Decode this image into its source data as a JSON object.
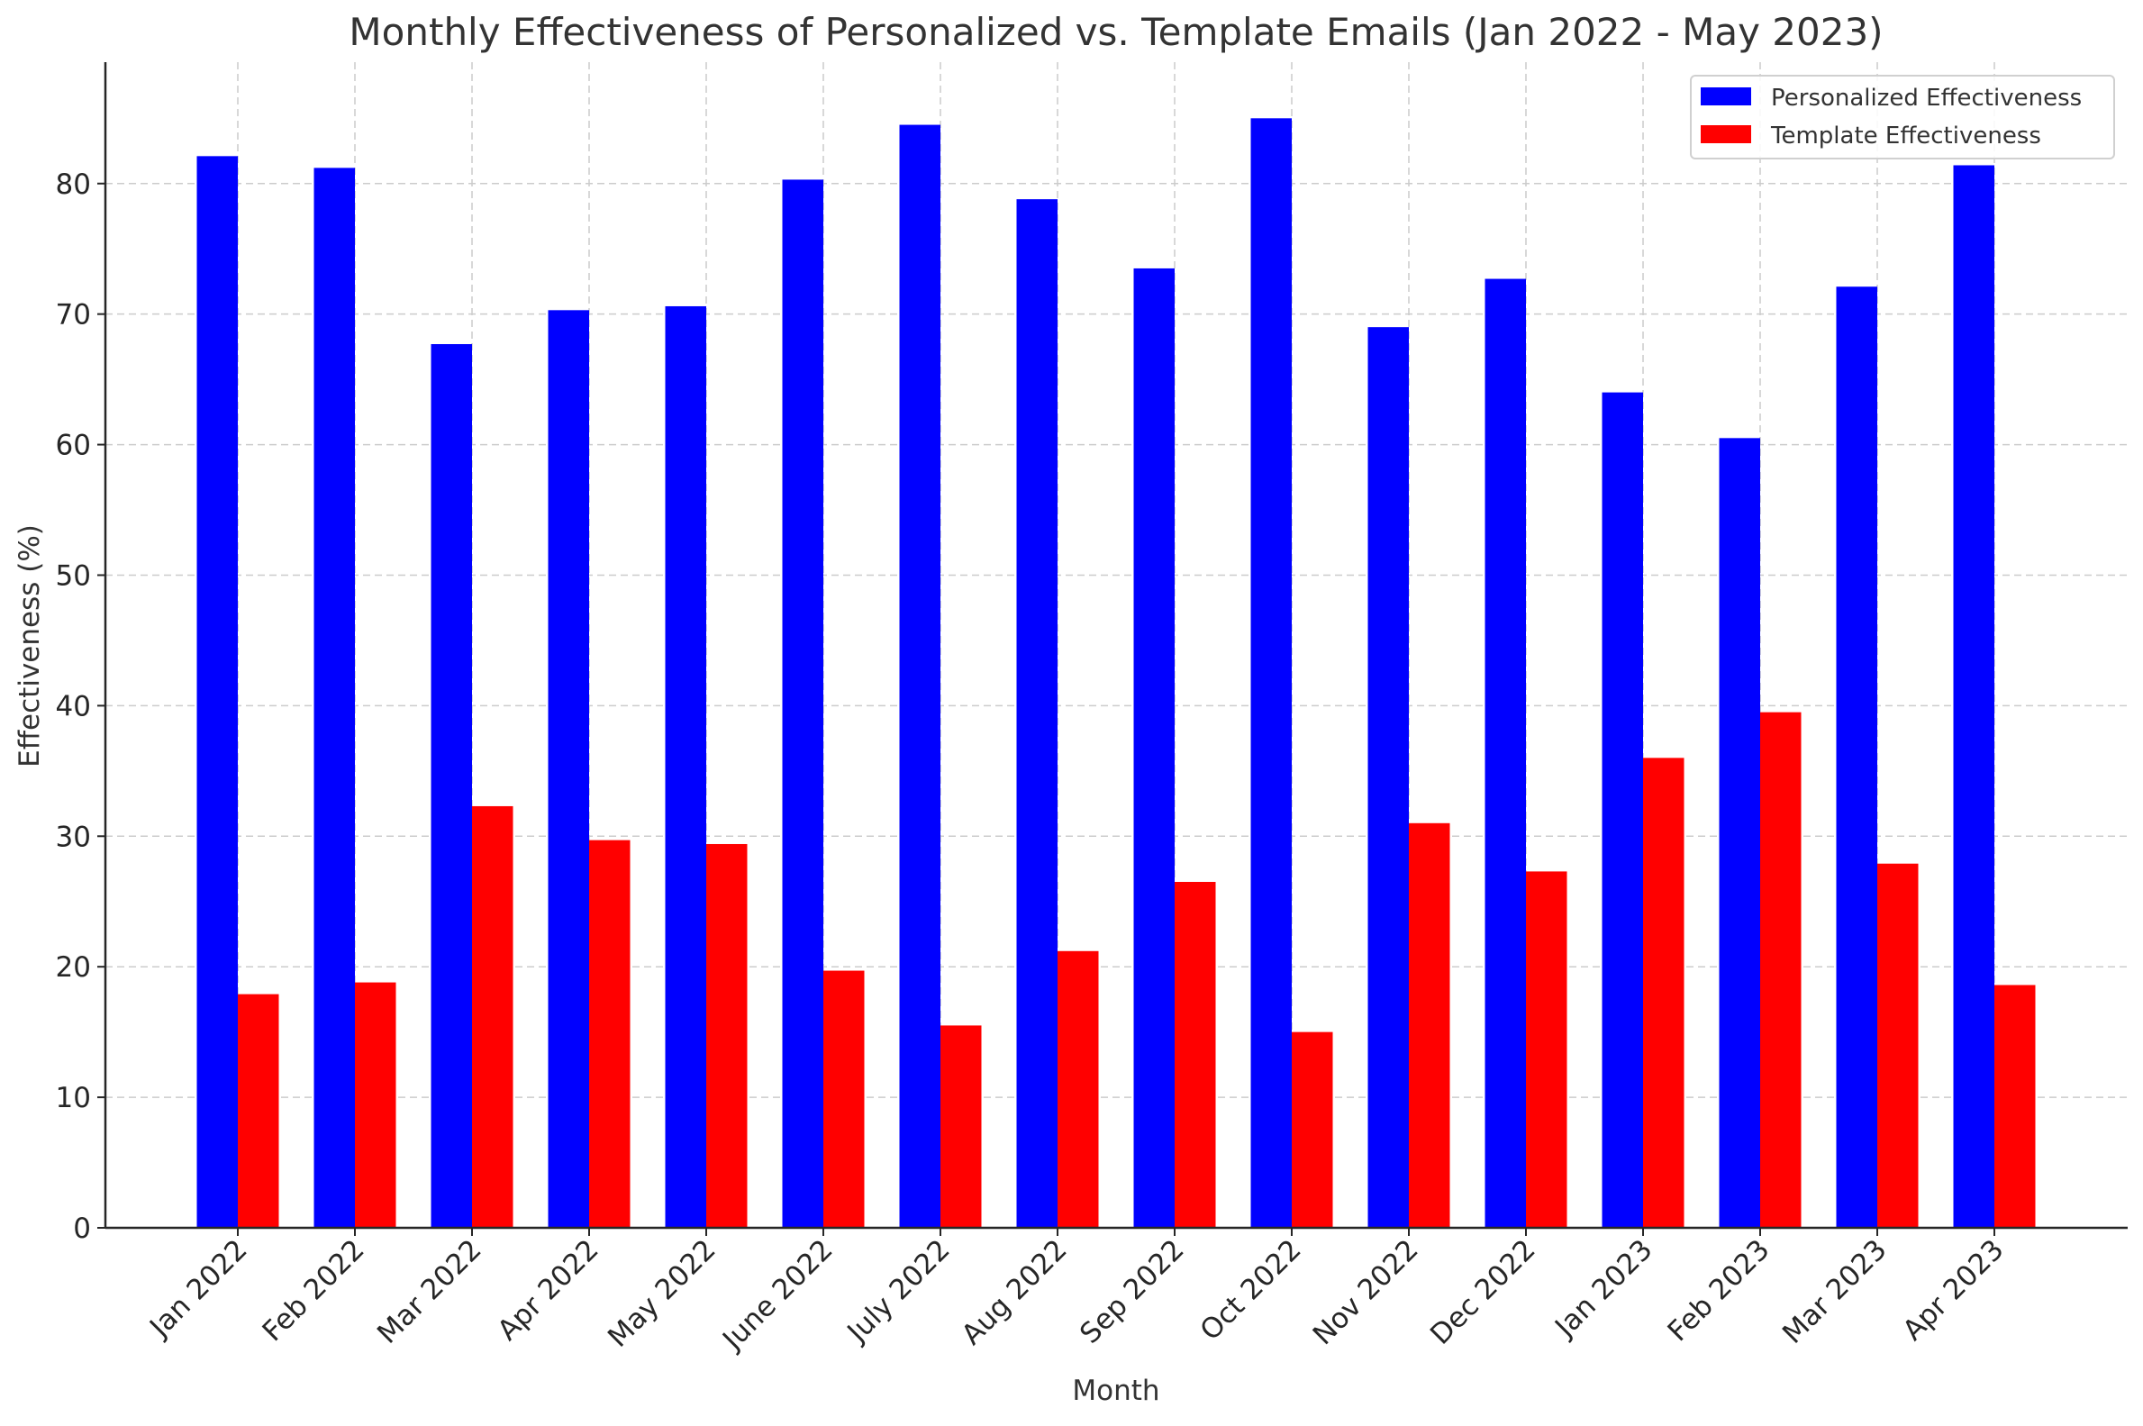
{
  "chart_data": {
    "type": "bar",
    "title": "Monthly Effectiveness of Personalized vs. Template Emails (Jan 2022 - May 2023)",
    "xlabel": "Month",
    "ylabel": "Effectiveness (%)",
    "ylim": [
      0,
      89.3
    ],
    "yticks": [
      0,
      10,
      20,
      30,
      40,
      50,
      60,
      70,
      80
    ],
    "grid": true,
    "legend_position": "top-right",
    "categories": [
      "Jan 2022",
      "Feb 2022",
      "Mar 2022",
      "Apr 2022",
      "May 2022",
      "June 2022",
      "July 2022",
      "Aug 2022",
      "Sep 2022",
      "Oct 2022",
      "Nov 2022",
      "Dec 2022",
      "Jan 2023",
      "Feb 2023",
      "Mar 2023",
      "Apr 2023"
    ],
    "series": [
      {
        "name": "Personalized Effectiveness",
        "color": "#0000ff",
        "values": [
          82.1,
          81.2,
          67.7,
          70.3,
          70.6,
          80.3,
          84.5,
          78.8,
          73.5,
          85.0,
          69.0,
          72.7,
          64.0,
          60.5,
          72.1,
          81.4
        ]
      },
      {
        "name": "Template Effectiveness",
        "color": "#ff0000",
        "values": [
          17.9,
          18.8,
          32.3,
          29.7,
          29.4,
          19.7,
          15.5,
          21.2,
          26.5,
          15.0,
          31.0,
          27.3,
          36.0,
          39.5,
          27.9,
          18.6
        ]
      }
    ]
  }
}
